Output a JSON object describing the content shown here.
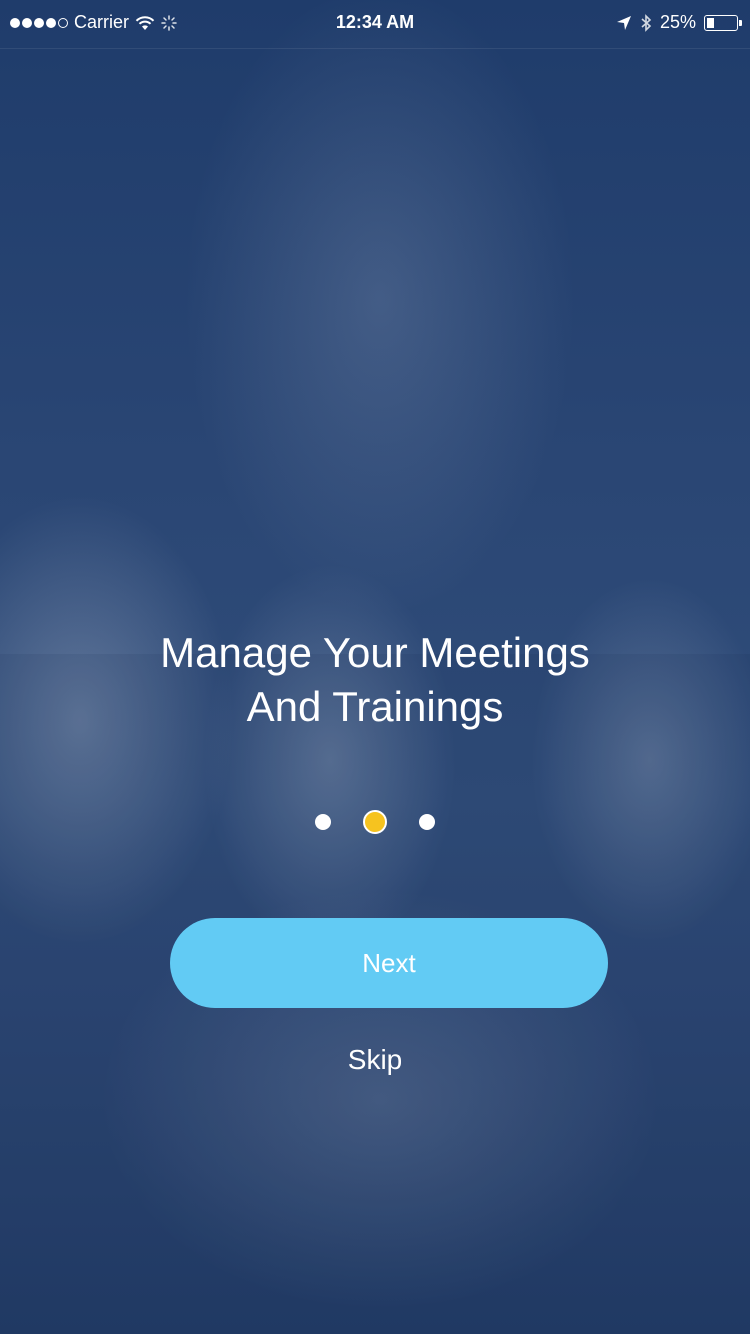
{
  "status_bar": {
    "carrier": "Carrier",
    "time": "12:34 AM",
    "battery_percent": "25%",
    "signal_bars_filled": 4,
    "signal_bars_total": 5,
    "battery_level": 0.25
  },
  "onboarding": {
    "title_line1": "Manage Your Meetings",
    "title_line2": "And Trainings",
    "page_count": 3,
    "active_page": 2,
    "next_label": "Next",
    "skip_label": "Skip"
  },
  "colors": {
    "background": "#2a4674",
    "accent_button": "#62cbf4",
    "active_dot": "#f6c31f",
    "text": "#ffffff"
  }
}
